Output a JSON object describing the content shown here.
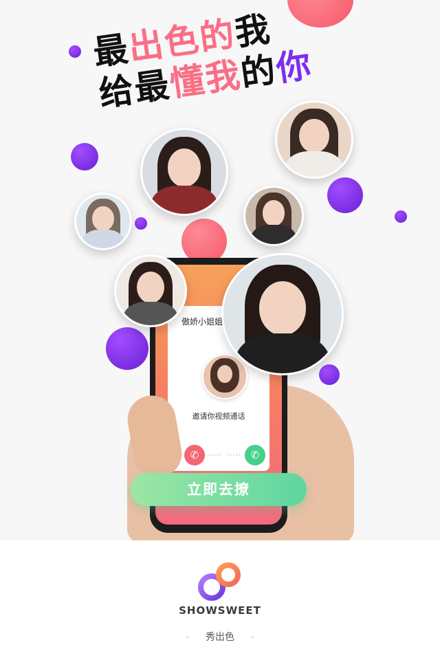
{
  "headline": {
    "line1_prefix": "最",
    "line1_highlight": "出色的",
    "line1_suffix": "我",
    "line2_prefix": "给最",
    "line2_highlight": "懂我",
    "line2_middle": "的",
    "line2_suffix": "你"
  },
  "phone": {
    "caller_name": "傲娇小姐姐",
    "call_message": "邀请你视频通话",
    "decline_icon": "phone-decline-icon",
    "accept_icon": "phone-accept-icon"
  },
  "cta": {
    "label": "立即去撩"
  },
  "footer": {
    "brand": "SHOWSWEET",
    "tagline": "秀出色",
    "tagline_left_dash": "-",
    "tagline_right_dash": "-"
  },
  "colors": {
    "accent_pink": "#fb6f85",
    "accent_purple": "#7d2ff0",
    "cta_green": "#5fd5a0",
    "screen_orange": "#f6815f"
  }
}
